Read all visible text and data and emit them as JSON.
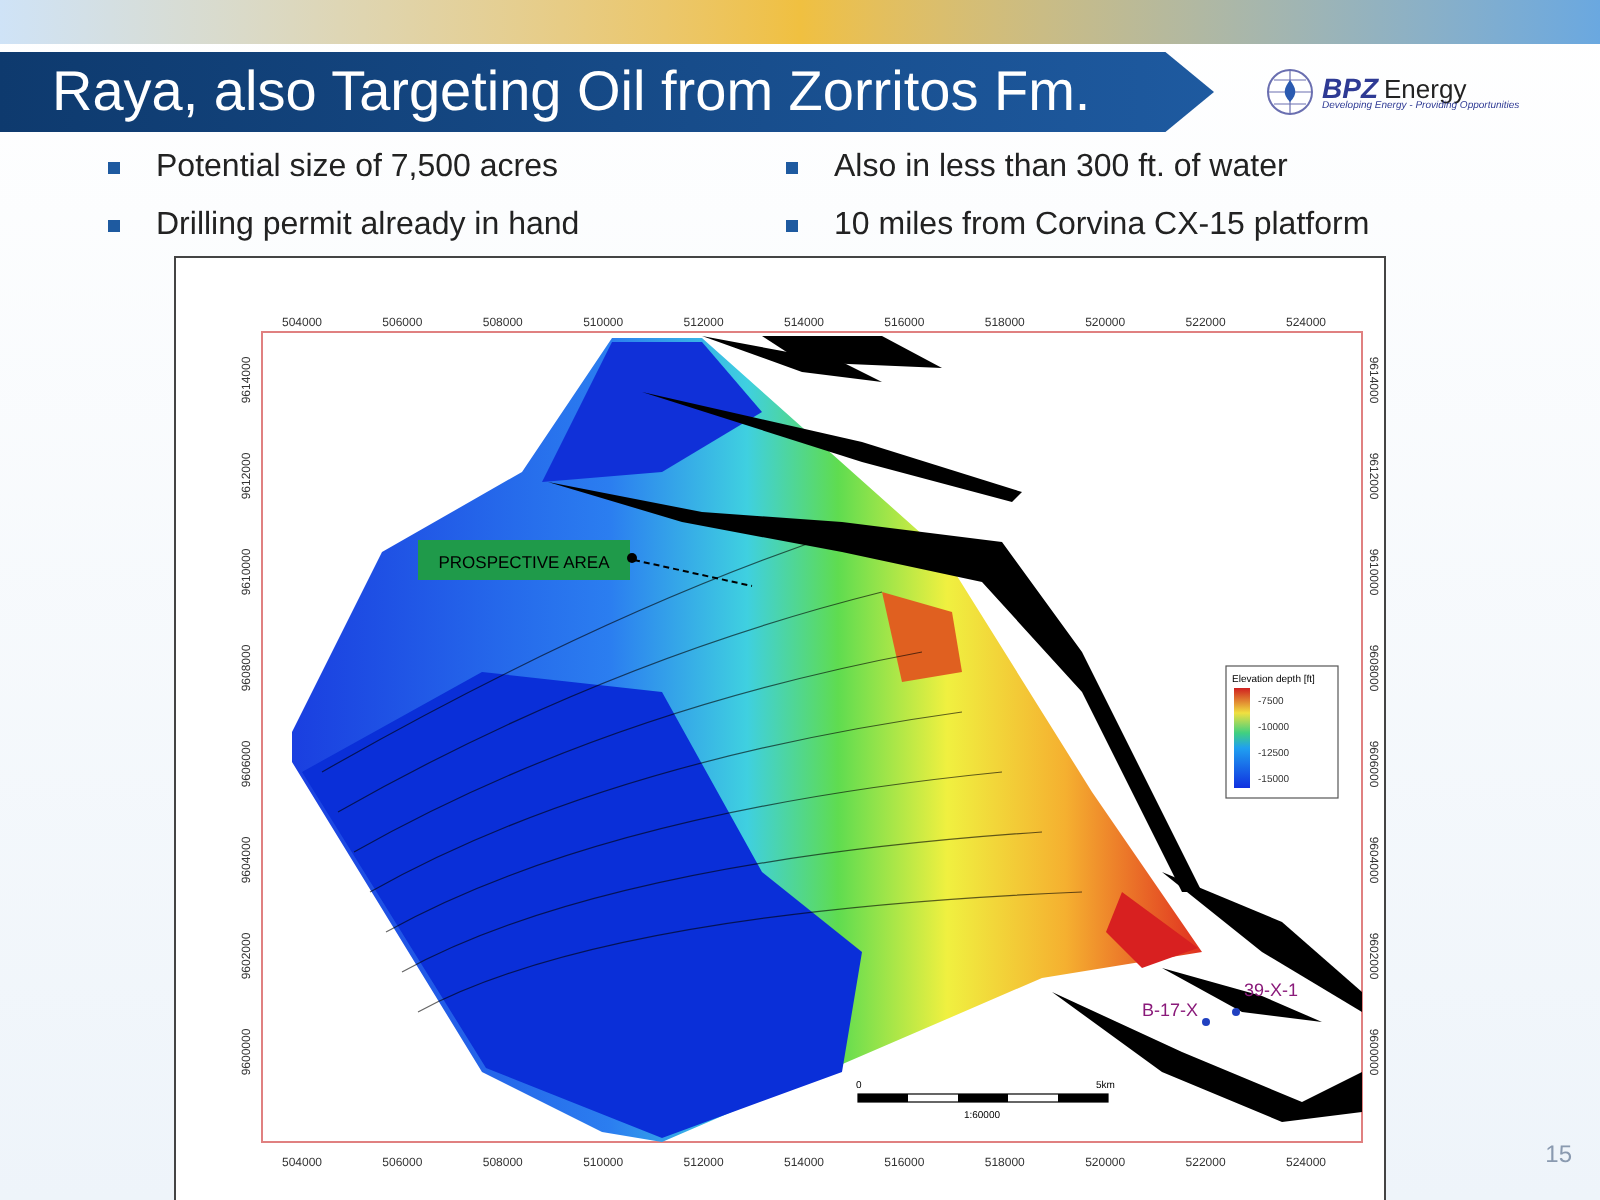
{
  "header": {
    "title": "Raya, also Targeting Oil from Zorritos Fm.",
    "logo": {
      "name": "BPZ",
      "suffix": "Energy",
      "tagline": "Developing Energy - Providing Opportunities"
    }
  },
  "bullet_columns": [
    {
      "items": [
        "Potential size of 7,500 acres",
        "Drilling permit already in hand"
      ]
    },
    {
      "items": [
        "Also in less than 300 ft. of water",
        "10 miles from Corvina CX-15 platform"
      ]
    }
  ],
  "map": {
    "x_axis_top_labels": [
      "504000",
      "506000",
      "508000",
      "510000",
      "512000",
      "514000",
      "516000",
      "518000",
      "520000",
      "522000",
      "524000"
    ],
    "x_axis_bottom_labels": [
      "504000",
      "506000",
      "508000",
      "510000",
      "512000",
      "514000",
      "516000",
      "518000",
      "520000",
      "522000",
      "524000"
    ],
    "y_axis_left_labels": [
      "9614000",
      "9612000",
      "9610000",
      "9608000",
      "9606000",
      "9604000",
      "9602000",
      "9600000"
    ],
    "y_axis_right_labels": [
      "9614000",
      "9612000",
      "9610000",
      "9608000",
      "9606000",
      "9604000",
      "9602000",
      "9600000"
    ],
    "callout": "PROSPECTIVE AREA",
    "wells": [
      {
        "label": "B-17-X"
      },
      {
        "label": "39-X-1"
      }
    ],
    "legend": {
      "title": "Elevation depth [ft]",
      "ticks": [
        "-7500",
        "-10000",
        "-12500",
        "-15000"
      ]
    },
    "scale_bar": {
      "start": "0",
      "end": "5km",
      "ratio": "1:60000"
    }
  },
  "page_number": "15"
}
